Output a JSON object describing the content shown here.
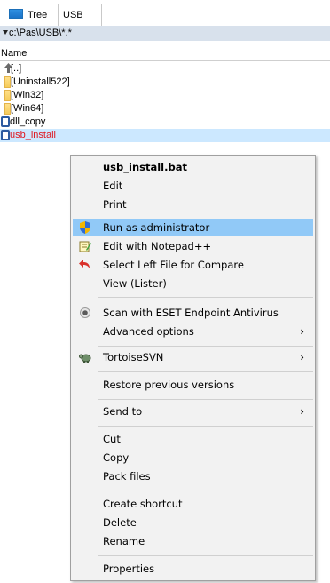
{
  "tabs": {
    "tree_label": "Tree",
    "usb_label": "USB"
  },
  "path": "c:\\Pas\\USB\\*.*",
  "list_header": "Name",
  "files": [
    {
      "name": "[..]",
      "icon": "up-dir-icon"
    },
    {
      "name": "[Uninstall522]",
      "icon": "folder-icon"
    },
    {
      "name": "[Win32]",
      "icon": "folder-icon"
    },
    {
      "name": "[Win64]",
      "icon": "folder-icon"
    },
    {
      "name": "dll_copy",
      "icon": "file-icon"
    },
    {
      "name": "usb_install",
      "icon": "file-icon",
      "selected": true
    }
  ],
  "menu": {
    "title": "usb_install.bat",
    "edit": "Edit",
    "print": "Print",
    "run_admin": "Run as administrator",
    "edit_notepad": "Edit with Notepad++",
    "select_compare": "Select Left File for Compare",
    "view_lister": "View (Lister)",
    "scan_eset": "Scan with ESET Endpoint Antivirus",
    "advanced": "Advanced options",
    "tortoise": "TortoiseSVN",
    "restore": "Restore previous versions",
    "send_to": "Send to",
    "cut": "Cut",
    "copy": "Copy",
    "pack": "Pack files",
    "create_shortcut": "Create shortcut",
    "delete": "Delete",
    "rename": "Rename",
    "properties": "Properties",
    "submenu_arrow": "›"
  },
  "colors": {
    "highlight": "#91c9f7",
    "selected_row": "#cce8ff",
    "selected_text": "#e0161f",
    "path_bg": "#d8e1ec"
  }
}
